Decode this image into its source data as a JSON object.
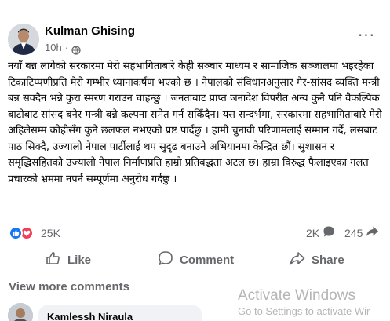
{
  "post": {
    "author": "Kulman Ghising",
    "time": "10h",
    "time_separator": "·",
    "more_label": "···",
    "text": "नयाँ बन्न लागेको सरकारमा मेरो सहभागिताबारे केही सञ्चार माध्यम र सामाजिक सञ्जालमा भइरहेका टिकाटिप्पणीप्रति मेरो गम्भीर ध्यानाकर्षण भएको छ । नेपालको संविधानअनुसार गैर-सांसद व्यक्ति मन्त्री बन्न सक्दैन भन्ने कुरा स्मरण गराउन चाहन्छु । जनताबाट प्राप्त जनादेश विपरीत अन्य कुनै पनि वैकल्पिक बाटोबाट सांसद बनेर मन्त्री बन्ने कल्पना समेत गर्न सकिँदैन। यस सन्दर्भमा, सरकारमा सहभागिताबारे मेरो अहिलेसम्म कोहीसँग कुनै छलफल नभएको प्रष्ट पार्दछु । हामी चुनावी परिणामलाई सम्मान गर्दै, लसबाट पाठ सिक्दै, उज्यालो नेपाल पार्टीलाई थप सुदृढ बनाउने अभियानमा केन्द्रित छौं। सुशासन र समृद्धिसहितको उज्यालो नेपाल निर्माणप्रति हाम्रो प्रतिबद्धता अटल छ। हाम्रा विरुद्ध फैलाइएका गलत प्रचारको भ्रममा नपर्न सम्पूर्णमा अनुरोध गर्दछु ।"
  },
  "stats": {
    "reactions": "25K",
    "comments": "2K",
    "shares": "245"
  },
  "actions": {
    "like": "Like",
    "comment": "Comment",
    "share": "Share"
  },
  "comments": {
    "view_more": "View more comments",
    "first_author": "Kamlessh Niraula"
  },
  "watermark": {
    "title": "Activate Windows",
    "subtitle": "Go to Settings to activate Wir"
  },
  "colors": {
    "like_blue": "#1877f2",
    "love_red": "#f33e58",
    "secondary_text": "#65676b"
  },
  "icons": [
    "globe-icon",
    "more-icon",
    "like-reaction-icon",
    "love-reaction-icon",
    "comment-bubble-icon",
    "share-arrow-icon",
    "thumbs-up-icon"
  ]
}
